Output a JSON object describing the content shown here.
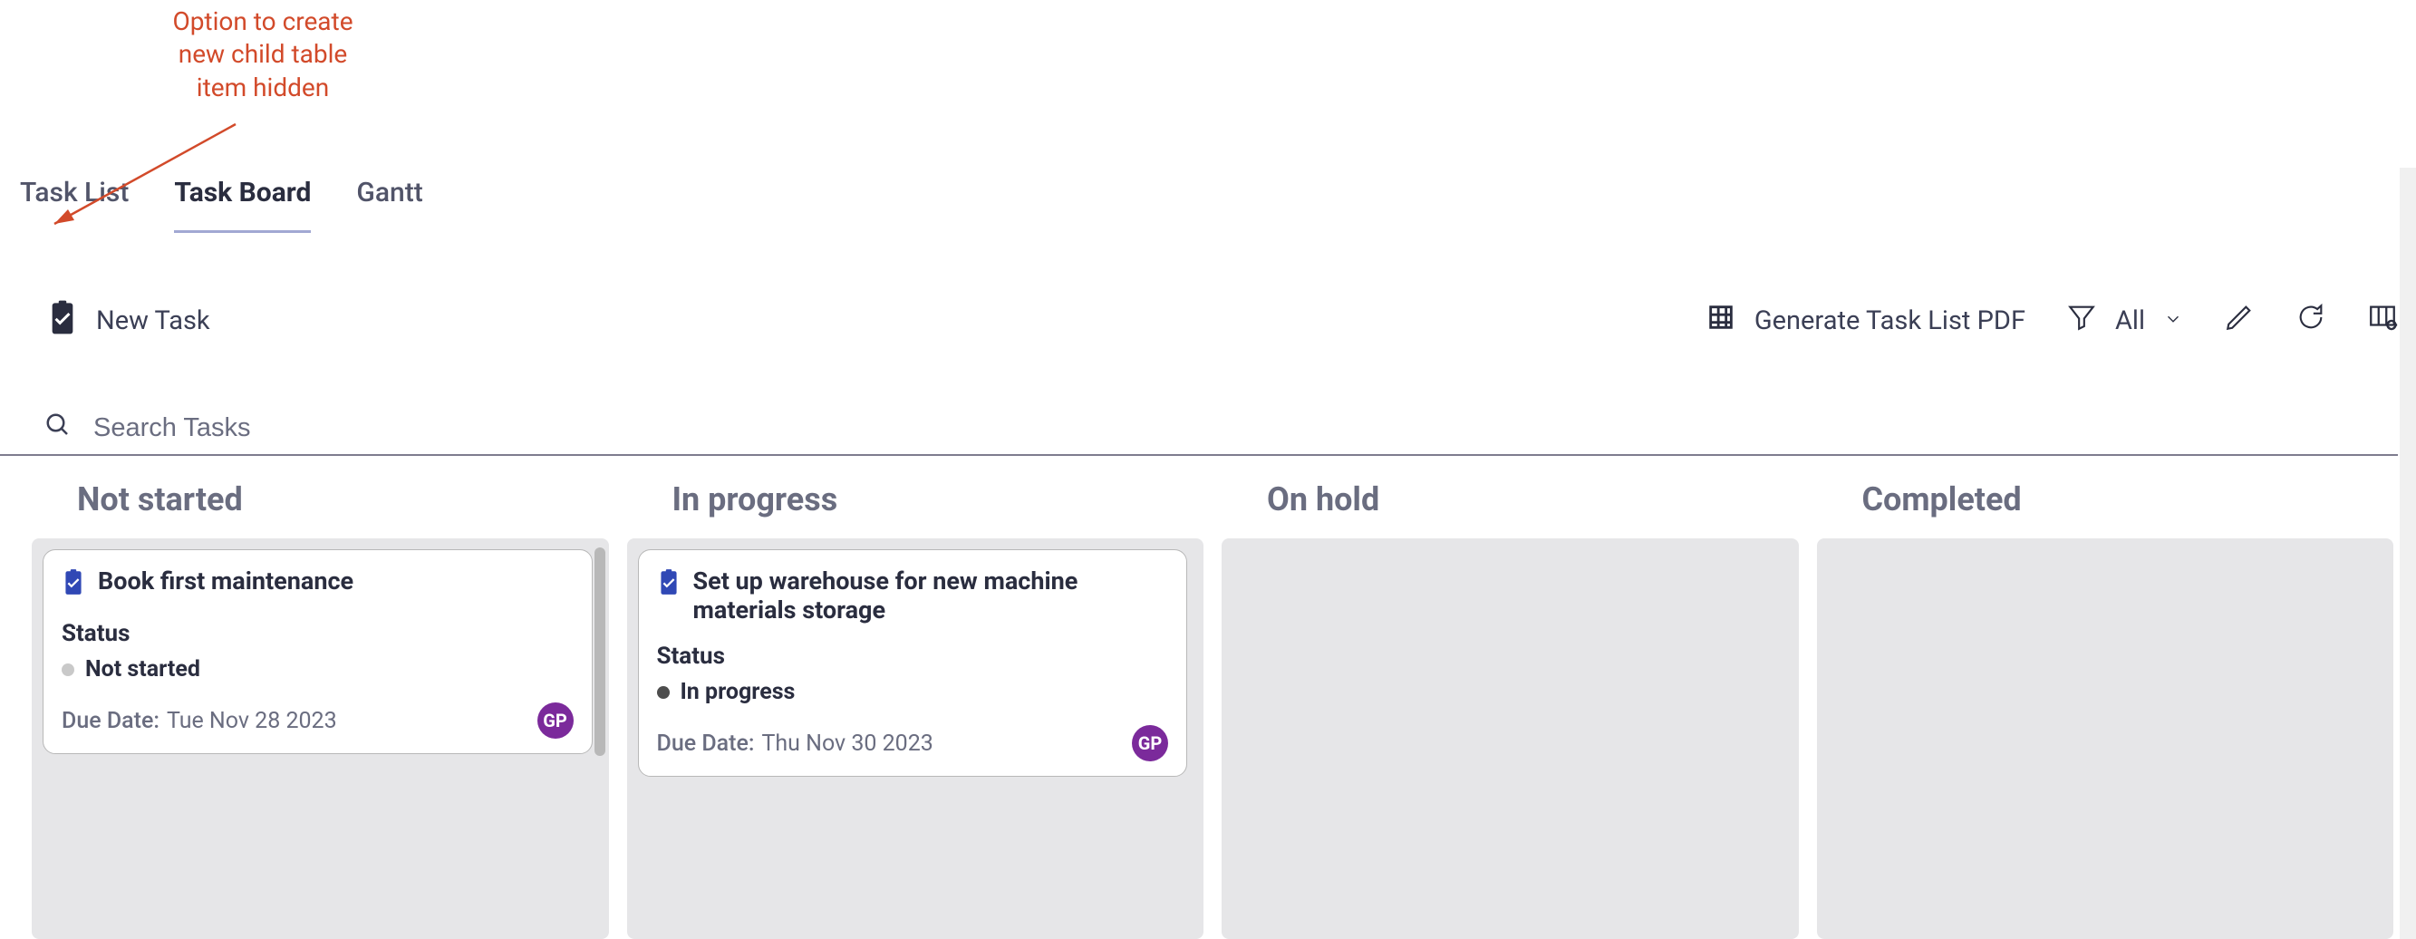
{
  "annotation": {
    "line1": "Option to create",
    "line2": "new child table",
    "line3": "item hidden"
  },
  "tabs": [
    {
      "label": "Task List",
      "active": false
    },
    {
      "label": "Task Board",
      "active": true
    },
    {
      "label": "Gantt",
      "active": false
    }
  ],
  "toolbar": {
    "new_task_label": "New Task",
    "generate_pdf_label": "Generate Task List PDF",
    "filter_label": "All"
  },
  "search": {
    "placeholder": "Search Tasks"
  },
  "board": {
    "columns": [
      {
        "title": "Not started",
        "cards": [
          {
            "title": "Book first maintenance",
            "status_label": "Status",
            "status_value": "Not started",
            "status_tone": "light",
            "due_label": "Due Date:",
            "due_value": "Tue Nov 28 2023",
            "assignee_initials": "GP"
          }
        ]
      },
      {
        "title": "In progress",
        "cards": [
          {
            "title": "Set up warehouse for new machine materials storage",
            "status_label": "Status",
            "status_value": "In progress",
            "status_tone": "dark",
            "due_label": "Due Date:",
            "due_value": "Thu Nov 30 2023",
            "assignee_initials": "GP"
          }
        ]
      },
      {
        "title": "On hold",
        "cards": []
      },
      {
        "title": "Completed",
        "cards": []
      }
    ]
  },
  "colors": {
    "accent_purple": "#7b2a9b",
    "tab_underline": "#a2a8d3",
    "annotation_red": "#d24a2a"
  }
}
